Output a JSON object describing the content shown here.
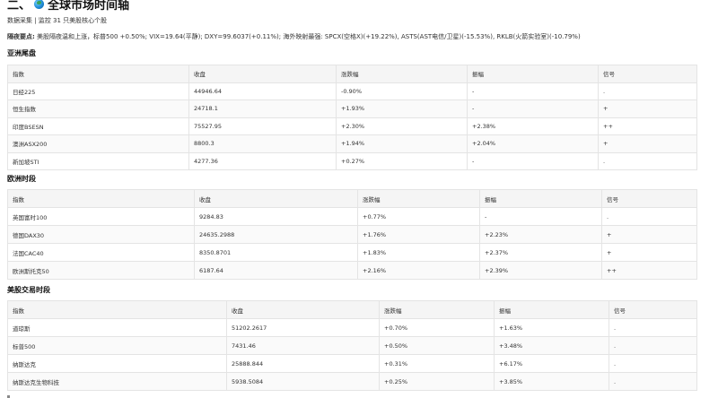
{
  "header": {
    "prefix": "二、",
    "title": "全球市场时间轴"
  },
  "meta": {
    "text": "数据采集 | 监控 31 只美股核心个股"
  },
  "summary": {
    "label": "隔夜要点:",
    "text": " 美股隔夜温和上涨，标普500 +0.50%; VIX=19.64(平静); DXY=99.6037(+0.11%); 海外映射最强: SPCX(空格X)(+19.22%), ASTS(AST电信/卫星)(-15.53%), RKLB(火箭实验室)(-10.79%)"
  },
  "sections": [
    {
      "title": "亚洲尾盘",
      "headers": [
        "指数",
        "收盘",
        "涨跌幅",
        "振幅",
        "信号"
      ],
      "rows": [
        [
          "日经225",
          "44946.64",
          "-0.90%",
          "-",
          "."
        ],
        [
          "恒生指数",
          "24718.1",
          "+1.93%",
          "-",
          "+"
        ],
        [
          "印度BSESN",
          "75527.95",
          "+2.30%",
          "+2.38%",
          "++"
        ],
        [
          "澳洲ASX200",
          "8800.3",
          "+1.94%",
          "+2.04%",
          "+"
        ],
        [
          "新加坡STI",
          "4277.36",
          "+0.27%",
          "-",
          "."
        ]
      ]
    },
    {
      "title": "欧洲时段",
      "headers": [
        "指数",
        "收盘",
        "涨跌幅",
        "振幅",
        "信号"
      ],
      "rows": [
        [
          "英国富时100",
          "9284.83",
          "+0.77%",
          "-",
          "."
        ],
        [
          "德国DAX30",
          "24635.2988",
          "+1.76%",
          "+2.23%",
          "+"
        ],
        [
          "法国CAC40",
          "8350.8701",
          "+1.83%",
          "+2.37%",
          "+"
        ],
        [
          "欧洲斯托克50",
          "6187.64",
          "+2.16%",
          "+2.39%",
          "++"
        ]
      ]
    },
    {
      "title": "美股交易时段",
      "headers": [
        "指数",
        "收盘",
        "涨跌幅",
        "振幅",
        "信号"
      ],
      "rows": [
        [
          "道琼斯",
          "51202.2617",
          "+0.70%",
          "+1.63%",
          "."
        ],
        [
          "标普500",
          "7431.46",
          "+0.50%",
          "+3.48%",
          "."
        ],
        [
          "纳斯达克",
          "25888.844",
          "+0.31%",
          "+6.17%",
          "."
        ],
        [
          "纳斯达克生物科技",
          "5938.5084",
          "+0.25%",
          "+3.85%",
          "."
        ]
      ]
    }
  ]
}
